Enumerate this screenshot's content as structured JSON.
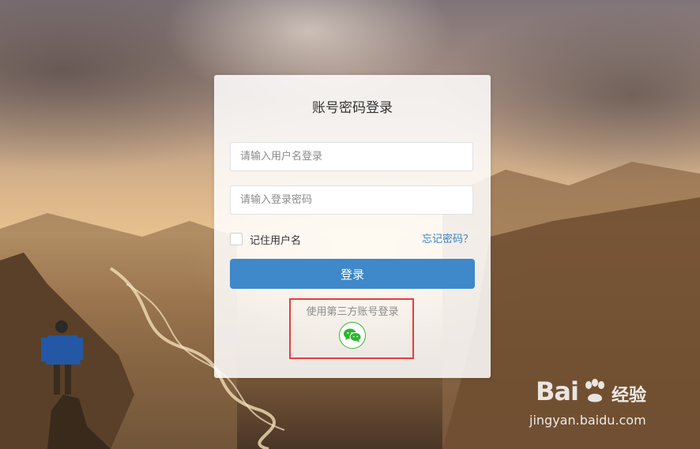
{
  "login": {
    "title": "账号密码登录",
    "username_placeholder": "请输入用户名登录",
    "password_placeholder": "请输入登录密码",
    "remember_label": "记住用户名",
    "forgot_label": "忘记密码？",
    "submit_label": "登录",
    "third_party_label": "使用第三方账号登录"
  },
  "watermark": {
    "brand": "Bai",
    "brand_suffix": "经验",
    "url": "jingyan.baidu.com"
  },
  "colors": {
    "primary": "#3f88c9",
    "link": "#3a82c4",
    "wechat": "#2fb52f",
    "highlight": "#e63d3d"
  }
}
